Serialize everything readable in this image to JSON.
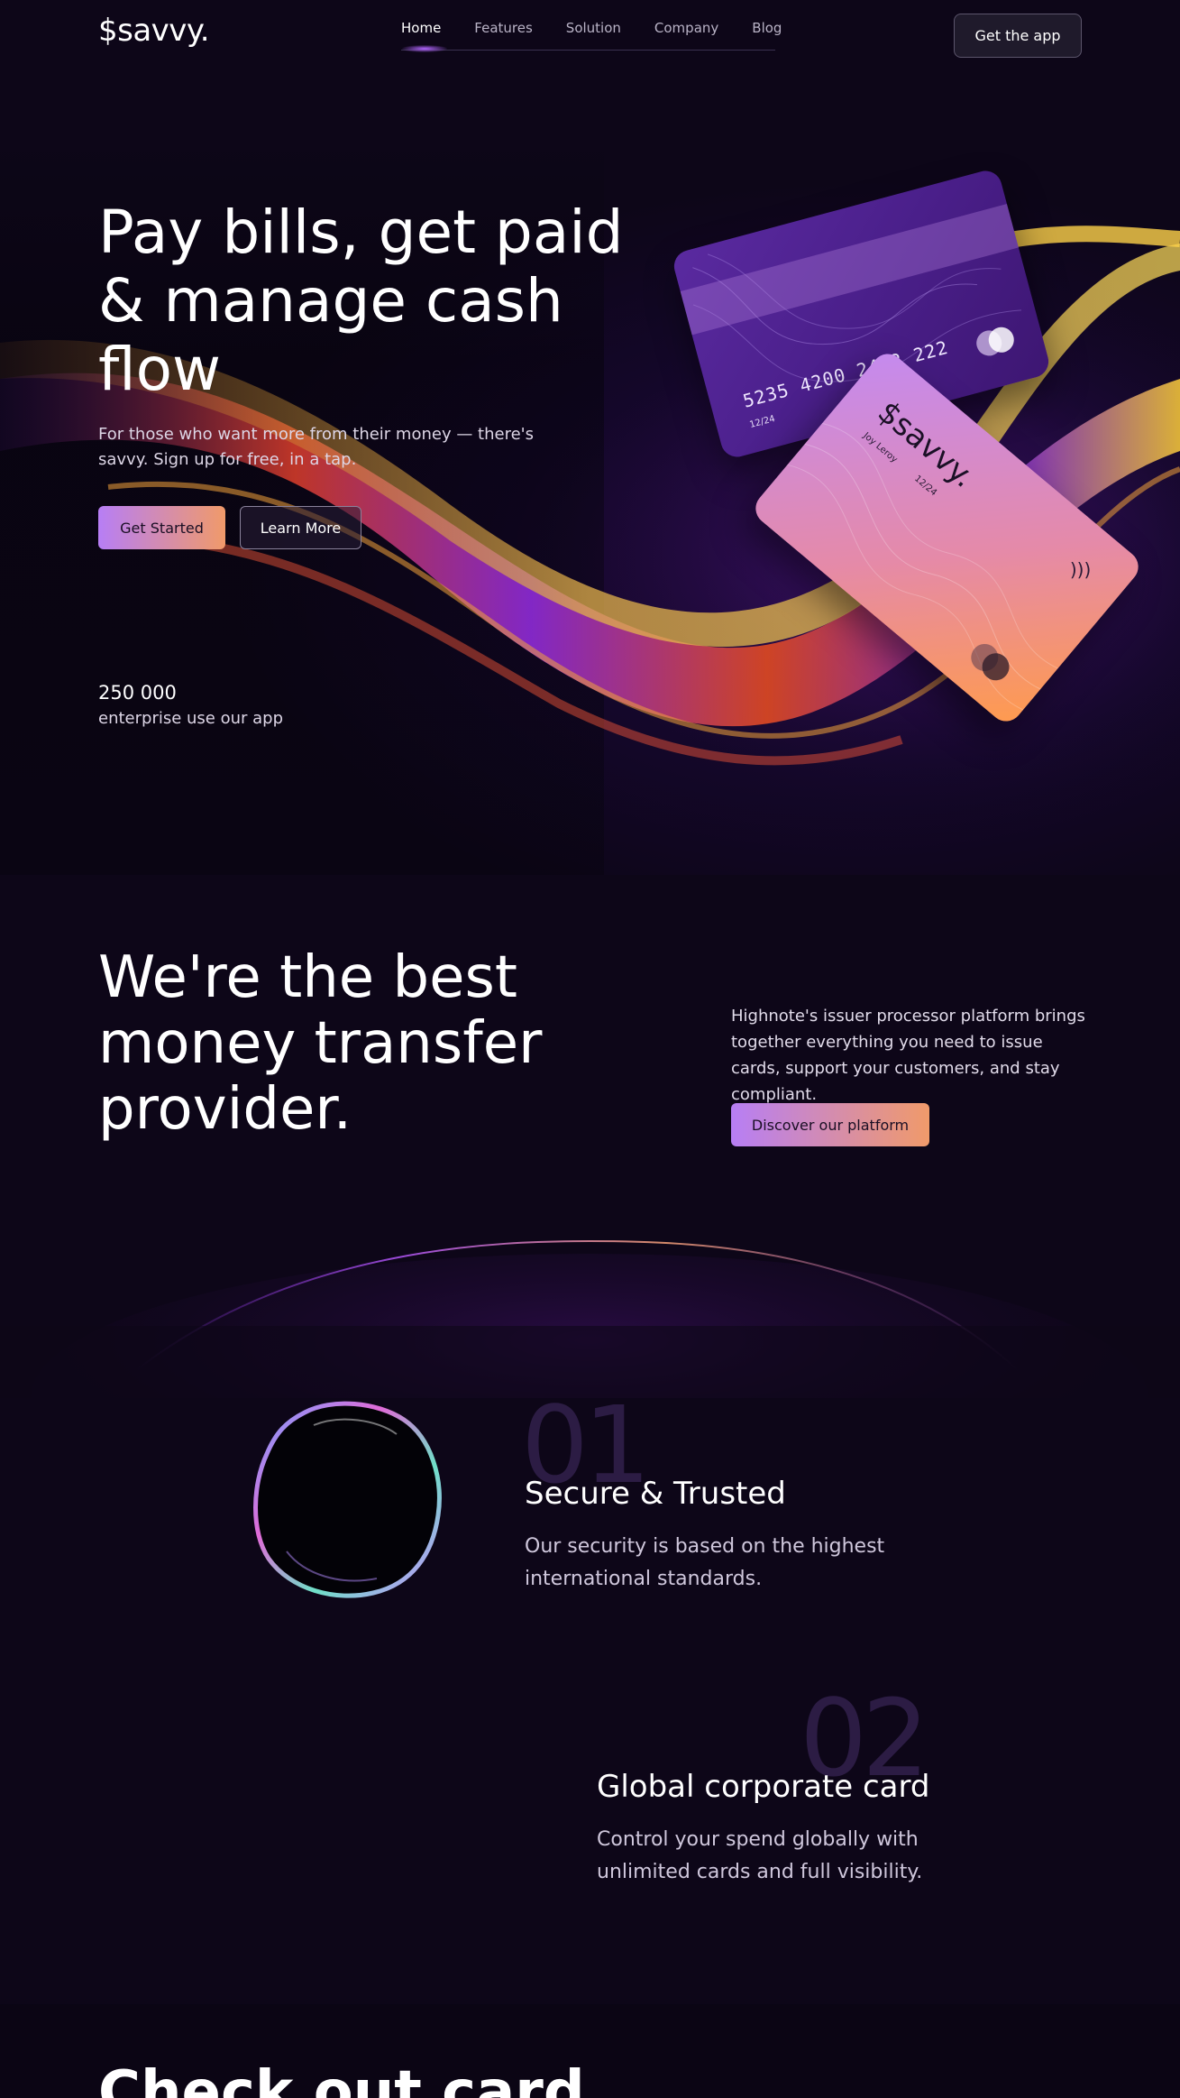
{
  "header": {
    "logo": "$savvy.",
    "nav": [
      "Home",
      "Features",
      "Solution",
      "Company",
      "Blog"
    ],
    "cta": "Get the app"
  },
  "hero": {
    "title": "Pay bills, get paid & manage cash flow",
    "subtitle": "For those who want more from their money — there's savvy. Sign up for free, in a tap.",
    "primary_button": "Get Started",
    "secondary_button": "Learn More",
    "stat_value": "250 000",
    "stat_label": "enterprise use our app",
    "card_back": {
      "number": "5235 4200 2432 222",
      "expiry": "12/24"
    },
    "card_front": {
      "brand": "$savvy.",
      "holder": "Joy Leroy",
      "expiry": "12/24"
    }
  },
  "about": {
    "title": "We're the best money transfer provider.",
    "text": "Highnote's issuer processor platform brings together everything you need to issue cards, support your customers, and stay compliant.",
    "button": "Discover our platform"
  },
  "features": [
    {
      "number": "01",
      "title": "Secure & Trusted",
      "description": "Our security is based on the highest international standards."
    },
    {
      "number": "02",
      "title": "Global corporate card",
      "description": "Control your spend globally with unlimited cards and full visibility."
    }
  ],
  "next_section": {
    "title": "Check out card"
  },
  "colors": {
    "background": "#0d0618",
    "accent_start": "#b77ef5",
    "accent_end": "#f09a6a"
  },
  "icons": [
    "contactless-icon",
    "card-circles-icon"
  ]
}
